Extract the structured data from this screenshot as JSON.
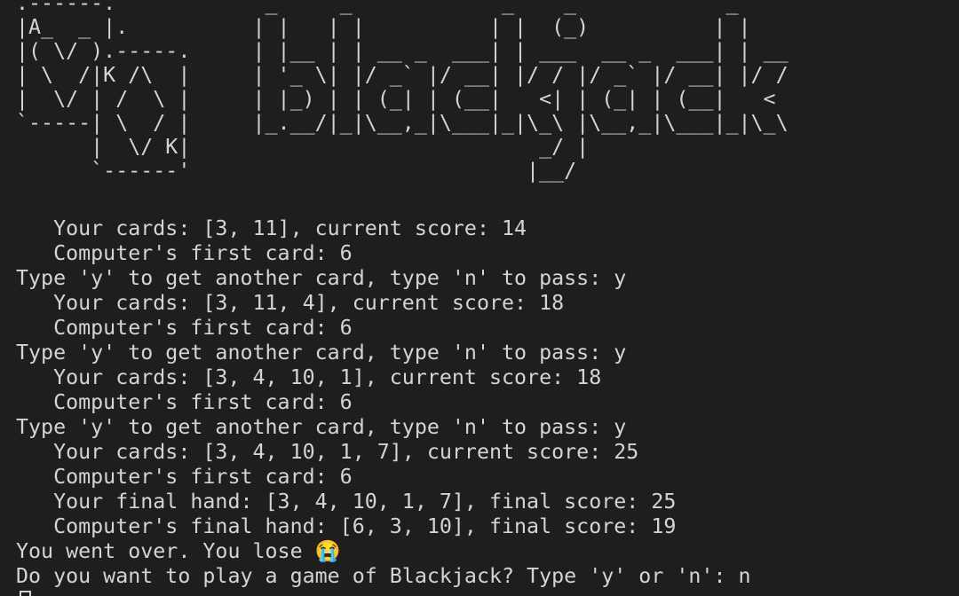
{
  "terminal": {
    "ascii_art": [
      ".------.            _     _            _    _            _    ",
      "|A_  _ |.          | |   | |          | |  (_)          | |   ",
      "|( \\/ ).-----.     | |__ | | __ _  ___| | ___  __ _  ___| | __",
      "| \\  /|K /\\  |     | '_ \\| |/ _` |/ __| |/ / |/ _` |/ __| |/ /",
      "|  \\/ | /  \\ |     | |_) | | (_| | (__|   <| | (_| | (__|   < ",
      "`-----| \\  / |     |_.__/|_|\\__,_|\\___|_|\\_\\ |\\__,_|\\___|_|\\_\\",
      "      |  \\/ K|                            _/ |                ",
      "      `------'                           |__/                 "
    ],
    "lines": [
      "   Your cards: [3, 11], current score: 14",
      "   Computer's first card: 6",
      "Type 'y' to get another card, type 'n' to pass: y",
      "   Your cards: [3, 11, 4], current score: 18",
      "   Computer's first card: 6",
      "Type 'y' to get another card, type 'n' to pass: y",
      "   Your cards: [3, 4, 10, 1], current score: 18",
      "   Computer's first card: 6",
      "Type 'y' to get another card, type 'n' to pass: y",
      "   Your cards: [3, 4, 10, 1, 7], current score: 25",
      "   Computer's first card: 6",
      "   Your final hand: [3, 4, 10, 1, 7], final score: 25",
      "   Computer's final hand: [6, 3, 10], final score: 19",
      "You went over. You lose 😭",
      "Do you want to play a game of Blackjack? Type 'y' or 'n': n"
    ],
    "prompt_text": ""
  }
}
